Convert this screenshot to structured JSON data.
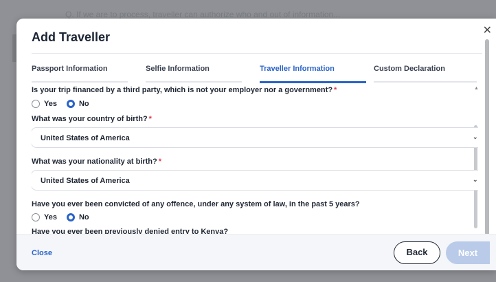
{
  "background": {
    "text": "Q. If we are to process, traveller can authorize who and out of information...",
    "dim_color": "#8f9196"
  },
  "modal": {
    "title": "Add Traveller",
    "close_glyph": "✕"
  },
  "tabs": [
    {
      "label": "Passport Information",
      "active": false
    },
    {
      "label": "Selfie Information",
      "active": false
    },
    {
      "label": "Traveller Information",
      "active": true
    },
    {
      "label": "Custom Declaration",
      "active": false
    }
  ],
  "form": {
    "q1": {
      "label": "Is your trip financed by a third party, which is not your employer nor a government?",
      "required_mark": "*",
      "options": [
        "Yes",
        "No"
      ],
      "selected": "No"
    },
    "q2": {
      "label": "What was your country of birth?",
      "required_mark": "*",
      "value": "United States of America"
    },
    "q3": {
      "label": "What was your nationality at birth?",
      "required_mark": "*",
      "value": "United States of America"
    },
    "q4": {
      "label": "Have you ever been convicted of any offence, under any system of law, in the past 5 years?",
      "options": [
        "Yes",
        "No"
      ],
      "selected": "No"
    },
    "q5": {
      "label": "Have you ever been previously denied entry to Kenya?"
    }
  },
  "footer": {
    "close_label": "Close",
    "back_label": "Back",
    "next_label": "Next"
  },
  "colors": {
    "accent": "#2a63c9",
    "required": "#e0374a",
    "next_disabled": "#b9cbe9"
  },
  "icons": {
    "chevron": "⌄",
    "scroll_up": "▲"
  }
}
